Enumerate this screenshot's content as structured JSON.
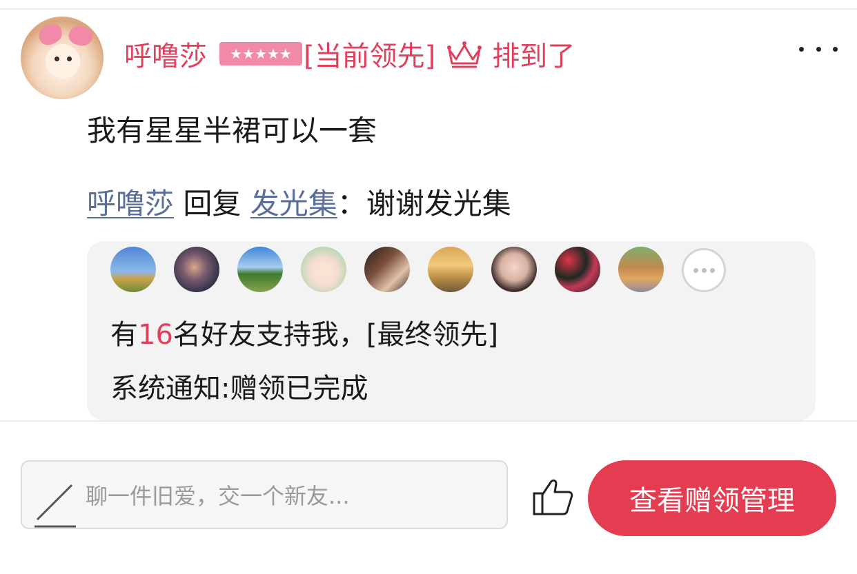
{
  "post": {
    "username": "呼噜莎",
    "rank_badge": {
      "stars": "★★★★★",
      "color": "#f08aa8"
    },
    "lead_tag": "[当前领先]",
    "crown_icon": "crown-icon",
    "status_text": "排到了",
    "comment_text": "我有星星半裙可以一套",
    "reply": {
      "from": "呼噜莎",
      "verb": "回复",
      "to": "发光集",
      "separator": "：",
      "text": "谢谢发光集"
    }
  },
  "support": {
    "friend_avatars": [
      "friend-avatar-1",
      "friend-avatar-2",
      "friend-avatar-3",
      "friend-avatar-4",
      "friend-avatar-5",
      "friend-avatar-6",
      "friend-avatar-7",
      "friend-avatar-8",
      "friend-avatar-9"
    ],
    "supporters_prefix": "有",
    "supporters_count": "16",
    "supporters_suffix": "名好友支持我，[最终领先]",
    "system_notice": "系统通知:赠领已完成"
  },
  "footer": {
    "comment_placeholder": "聊一件旧爱，交一个新友...",
    "like_icon": "thumbs-up-icon",
    "manage_button_label": "查看赠领管理"
  },
  "colors": {
    "accent": "#e0405b",
    "button": "#e43c50",
    "link": "#5a6e9a",
    "panel": "#f3f3f3"
  }
}
